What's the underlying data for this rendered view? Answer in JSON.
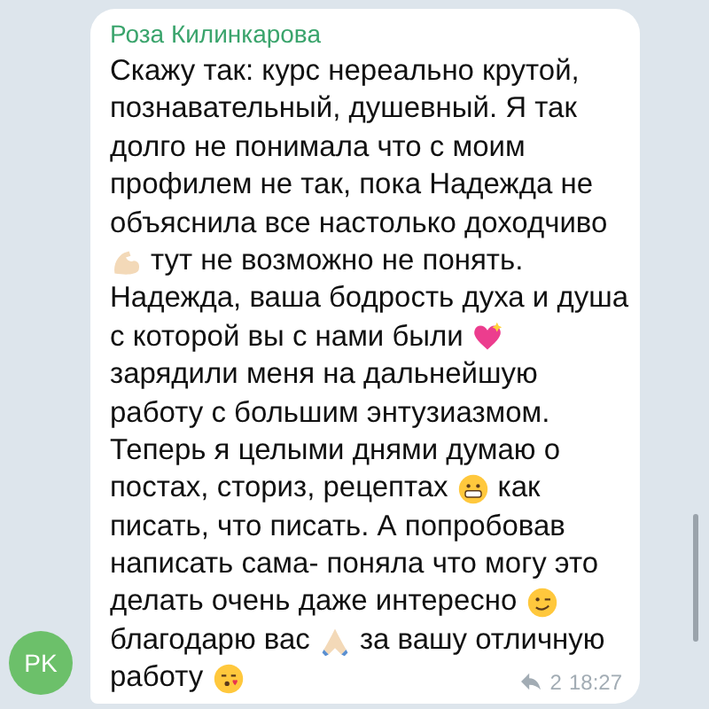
{
  "message": {
    "sender": "Роза Килинкарова",
    "lines": [
      [
        {
          "kind": "text",
          "text": "Скажу так: курс нереально крутой,"
        }
      ],
      [
        {
          "kind": "text",
          "text": "познавательный, душевный. Я так"
        }
      ],
      [
        {
          "kind": "text",
          "text": "долго не понимала что с моим"
        }
      ],
      [
        {
          "kind": "text",
          "text": "профилем не так, пока Надежда не"
        }
      ],
      [
        {
          "kind": "text",
          "text": "объяснила все настолько доходчиво"
        }
      ],
      [
        {
          "kind": "emoji"
        },
        {
          "kind": "text",
          "text": "тут не возможно не понять."
        }
      ],
      [
        {
          "kind": "text",
          "text": "Надежда, ваша бодрость духа и душа"
        }
      ],
      [
        {
          "kind": "text",
          "text": "с которой вы с нами были"
        },
        {
          "kind": "emoji"
        }
      ],
      [
        {
          "kind": "text",
          "text": "зарядили меня на дальнейшую"
        }
      ],
      [
        {
          "kind": "text",
          "text": "работу с большим энтузиазмом."
        }
      ],
      [
        {
          "kind": "text",
          "text": "Теперь я целыми днями думаю о"
        }
      ],
      [
        {
          "kind": "text",
          "text": "постах, сториз, рецептах"
        },
        {
          "kind": "emoji"
        },
        {
          "kind": "text",
          "text": "как"
        }
      ],
      [
        {
          "kind": "text",
          "text": "писать, что писать. А попробовав"
        }
      ],
      [
        {
          "kind": "text",
          "text": "написать сама- поняла что могу это"
        }
      ],
      [
        {
          "kind": "text",
          "text": "делать очень даже интересно"
        },
        {
          "kind": "emoji"
        }
      ],
      [
        {
          "kind": "text",
          "text": "благодарю вас"
        },
        {
          "kind": "emoji"
        },
        {
          "kind": "text",
          "text": "за вашу отличную"
        }
      ],
      [
        {
          "kind": "text",
          "text": "работу"
        },
        {
          "kind": "emoji"
        }
      ]
    ],
    "forwards": "2",
    "time": "18:27",
    "avatar_initials": "PK"
  }
}
